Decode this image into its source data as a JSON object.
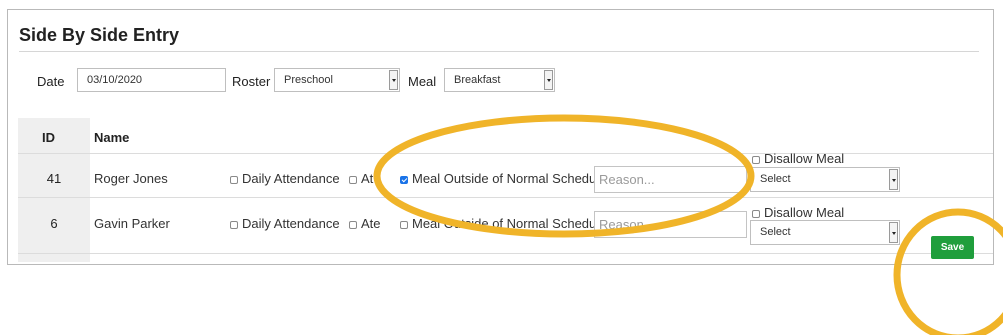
{
  "page": {
    "title": "Side By Side Entry"
  },
  "filters": {
    "date_label": "Date",
    "date_value": "03/10/2020",
    "roster_label": "Roster",
    "roster_value": "Preschool",
    "meal_label": "Meal",
    "meal_value": "Breakfast"
  },
  "table": {
    "columns": [
      "ID",
      "Name"
    ],
    "rows": [
      {
        "id": "41",
        "name": "Roger Jones",
        "daily_attendance_label": "Daily Attendance",
        "daily_attendance_checked": false,
        "ate_label": "At",
        "ate_checked": false,
        "meal_outside_label": "Meal Outside of Normal Schedule",
        "meal_outside_checked": true,
        "reason_placeholder": "Reason...",
        "disallow_meal_label": "Disallow Meal",
        "disallow_meal_checked": false,
        "select_value": "Select"
      },
      {
        "id": "6",
        "name": "Gavin Parker",
        "daily_attendance_label": "Daily Attendance",
        "daily_attendance_checked": false,
        "ate_label": "Ate",
        "ate_checked": false,
        "meal_outside_label": "Meal Outside of Normal Schedule",
        "meal_outside_checked": false,
        "reason_placeholder": "Reason...",
        "disallow_meal_label": "Disallow Meal",
        "disallow_meal_checked": false,
        "select_value": "Select"
      }
    ]
  },
  "actions": {
    "save_label": "Save"
  },
  "colors": {
    "annotation": "#f0b429",
    "save_button": "#1f9e3c",
    "checkbox_checked": "#1a73e8",
    "id_column_bg": "#efefef"
  }
}
